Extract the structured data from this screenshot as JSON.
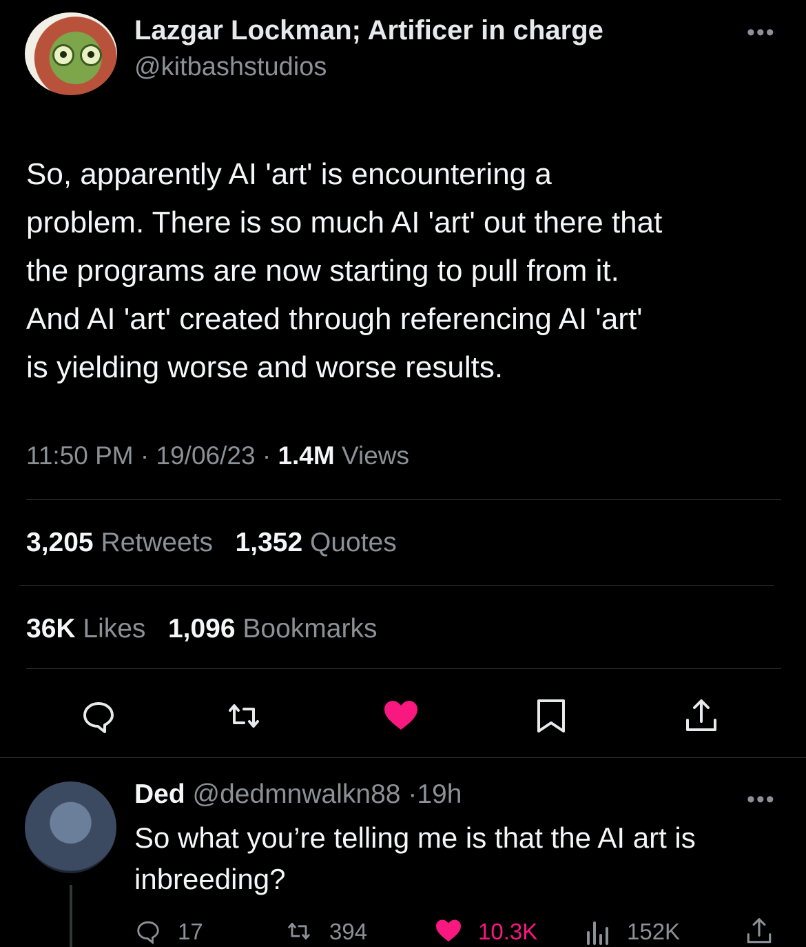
{
  "tweet": {
    "author_name": "Lazgar Lockman; Artificer in charge",
    "author_handle": "@kitbashstudios",
    "text": "So, apparently AI 'art' is encountering a\nproblem.  There is so much AI 'art' out there that\nthe programs are now starting to pull from it.\nAnd AI 'art' created through referencing AI 'art'\nis yielding worse and worse results.",
    "time": "11:50 PM",
    "date": "19/06/23",
    "views_count": "1.4M",
    "views_label": "Views",
    "retweets_count": "3,205",
    "retweets_label": "Retweets",
    "quotes_count": "1,352",
    "quotes_label": "Quotes",
    "likes_count": "36K",
    "likes_label": "Likes",
    "bookmarks_count": "1,096",
    "bookmarks_label": "Bookmarks"
  },
  "reply": {
    "author_name": "Ded",
    "author_handle": "@dedmnwalkn88",
    "age": "19h",
    "text": "So what you’re telling me is that the AI art is inbreeding?",
    "replies": "17",
    "retweets": "394",
    "likes": "10.3K",
    "views": "152K"
  },
  "colors": {
    "background": "#000000",
    "text": "#e7e9ea",
    "muted": "#8b9197",
    "like": "#f91880",
    "divider": "#2f3336"
  },
  "icons": [
    "more-icon",
    "reply-icon",
    "retweet-icon",
    "like-icon",
    "bookmark-icon",
    "share-icon",
    "views-icon"
  ]
}
